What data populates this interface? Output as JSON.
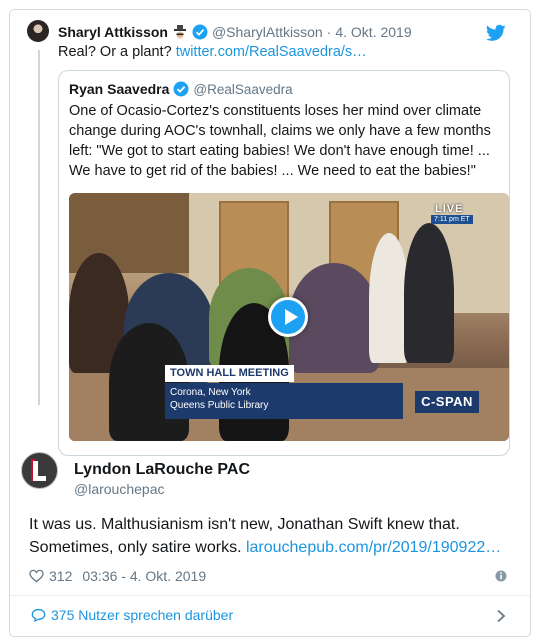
{
  "parent_tweet": {
    "name": "Sharyl Attkisson",
    "handle": "@SharylAttkisson",
    "separator": "·",
    "date": "4. Okt. 2019",
    "text": "Real? Or a plant? ",
    "link_text": "twitter.com/RealSaavedra/s…",
    "icons": [
      "spy-emoji-icon",
      "verified-badge-icon",
      "twitter-bird-icon"
    ]
  },
  "quoted_tweet": {
    "name": "Ryan Saavedra",
    "handle": "@RealSaavedra",
    "text": "One of Ocasio-Cortez's constituents loses her mind over climate change during AOC's townhall, claims we only have a few months left: \"We got to start eating babies! We don't have enough time! ... We have to get rid of the babies! ... We need to eat the babies!\"",
    "video": {
      "live_label": "LIVE",
      "live_time": "7:11 pm ET",
      "lower_third_title": "TOWN HALL MEETING",
      "lower_third_line1": "Corona, New York",
      "lower_third_line2": "Queens Public Library",
      "network": "C-SPAN"
    }
  },
  "reply": {
    "name": "Lyndon LaRouche PAC",
    "handle": "@larouchepac",
    "text": "It was us. Malthusianism isn't new, Jonathan Swift knew that. Sometimes, only satire works. ",
    "link_text": "larouchepub.com/pr/2019/190922…",
    "likes": "312",
    "time": "03:36 - 4. Okt. 2019"
  },
  "footer": {
    "talk_label": "375 Nutzer sprechen darüber"
  },
  "colors": {
    "link": "#1b95e0",
    "twitter_blue": "#1da1f2",
    "text": "#14171a",
    "muted": "#657786",
    "border": "#ccd6dd"
  }
}
